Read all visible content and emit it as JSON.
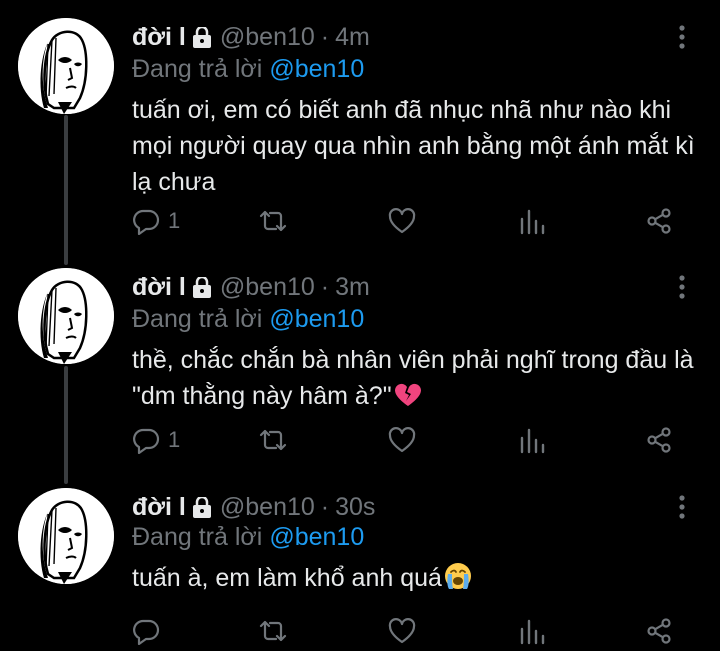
{
  "tweets": [
    {
      "display_name": "đời l",
      "handle": "@ben10",
      "separator": "·",
      "time": "4m",
      "replying_label": "Đang trả lời",
      "replying_to": "@ben10",
      "text": "tuấn ơi, em có biết anh đã nhục nhã như nào khi mọi người quay qua nhìn anh bằng một ánh mắt kì lạ chưa",
      "emoji": "",
      "reply_count": "1",
      "retweet_count": "",
      "like_count": ""
    },
    {
      "display_name": "đời l",
      "handle": "@ben10",
      "separator": "·",
      "time": "3m",
      "replying_label": "Đang trả lời",
      "replying_to": "@ben10",
      "text": "thề, chắc chắn bà nhân viên phải nghĩ trong đầu là \"dm thằng này hâm à?\"",
      "emoji": "broken-heart",
      "reply_count": "1",
      "retweet_count": "",
      "like_count": ""
    },
    {
      "display_name": "đời l",
      "handle": "@ben10",
      "separator": "·",
      "time": "30s",
      "replying_label": "Đang trả lời",
      "replying_to": "@ben10",
      "text": "tuấn à, em làm khổ anh quá",
      "emoji": "loudly-crying-face",
      "reply_count": "",
      "retweet_count": "",
      "like_count": ""
    }
  ],
  "icons": {
    "lock": "lock-icon",
    "more": "more-options-icon",
    "reply": "reply-icon",
    "retweet": "retweet-icon",
    "like": "heart-icon",
    "views": "views-icon",
    "share": "share-icon"
  },
  "colors": {
    "background": "#000000",
    "text_primary": "#e7e9ea",
    "text_secondary": "#71767b",
    "accent": "#1d9bf0",
    "thread_line": "#3a3d40",
    "broken_heart": "#f0447e",
    "crying_face": "#ffcc4d"
  }
}
